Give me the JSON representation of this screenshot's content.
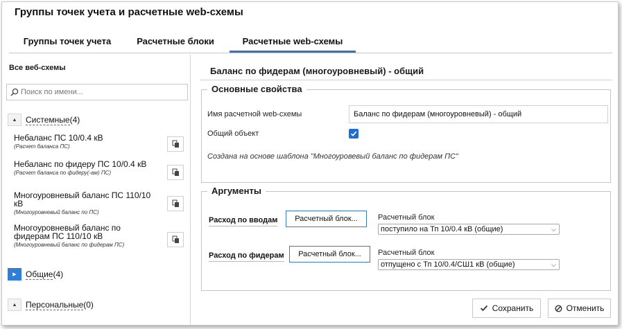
{
  "window": {
    "title": "Группы точек учета и расчетные web-схемы"
  },
  "tabs": [
    {
      "label": "Группы точек учета",
      "active": false
    },
    {
      "label": "Расчетные блоки",
      "active": false
    },
    {
      "label": "Расчетные web-схемы",
      "active": true
    }
  ],
  "sidebar": {
    "title": "Все веб-схемы",
    "search_placeholder": "Поиск по имени...",
    "groups": [
      {
        "label": "Системные",
        "count": "(4)",
        "expanded": true
      },
      {
        "label": "Общие",
        "count": "(4)",
        "expanded": false
      },
      {
        "label": "Персональные",
        "count": "(0)",
        "expanded": true
      }
    ],
    "items": [
      {
        "title": "Небаланс ПС 10/0.4 кВ",
        "subtitle": "(Расчет баланса ПС)"
      },
      {
        "title": "Небаланс по фидеру ПС 10/0.4 кВ",
        "subtitle": "(Расчет баланса по фидеру(-ам) ПС)"
      },
      {
        "title": "Многоуровневый баланс ПС 110/10 кВ",
        "subtitle": "(Многоуровневый баланс по ПС)"
      },
      {
        "title": "Многоуровневый баланс по фидерам ПС 110/10 кВ",
        "subtitle": "(Многоуровневый баланс по фидерам ПС)"
      }
    ]
  },
  "main": {
    "title": "Баланс по фидерам (многоуровневый) - общий",
    "properties": {
      "legend": "Основные свойства",
      "name_label": "Имя расчетной web-схемы",
      "name_value": "Баланс по фидерам (многоуровневый) - общий",
      "shared_label": "Общий объект",
      "shared_checked": true,
      "note": "Создана на основе шаблона \"Многоуровевый баланс по фидерам ПС\""
    },
    "arguments": {
      "legend": "Аргументы",
      "rows": [
        {
          "label": "Расход по вводам",
          "button": "Расчетный блок...",
          "select_caption": "Расчетный блок",
          "select_value": "поступило на Тп 10/0.4 кВ (общие)"
        },
        {
          "label": "Расход по фидерам",
          "button": "Расчетный блок...",
          "select_caption": "Расчетный блок",
          "select_value": "отпущено с Тп 10/0.4/СШ1 кВ (общие)"
        }
      ]
    },
    "buttons": {
      "save": "Сохранить",
      "cancel": "Отменить"
    }
  },
  "colors": {
    "accent": "#2979c4",
    "checkbox": "#1f6fd1",
    "expand_button": "#2f7ed8"
  },
  "icons": {
    "search": "search-icon",
    "copy": "copy-icon",
    "save": "checkmark-icon",
    "cancel": "cancel-icon",
    "collapse": "caret-up-icon",
    "expand": "caret-right-icon"
  }
}
